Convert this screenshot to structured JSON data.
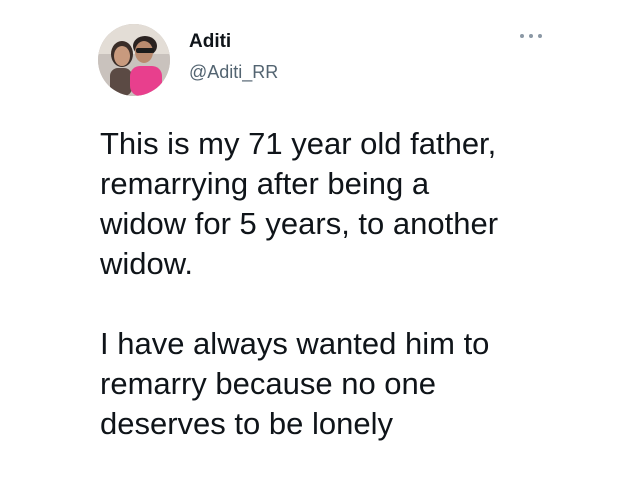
{
  "tweet": {
    "author": {
      "name": "Aditi",
      "handle": "@Aditi_RR",
      "avatar": "profile-photo"
    },
    "menu_icon": "more-horizontal-icon",
    "paragraphs": [
      {
        "lines": [
          "This is my 71 year old father,",
          "remarrying after being a",
          "widow for 5 years, to another",
          "widow."
        ]
      },
      {
        "lines": [
          "I have always wanted him to",
          "remarry because no one",
          "deserves to be lonely"
        ]
      }
    ]
  },
  "colors": {
    "text": "#0f1419",
    "secondary": "#536471",
    "background": "#ffffff"
  }
}
